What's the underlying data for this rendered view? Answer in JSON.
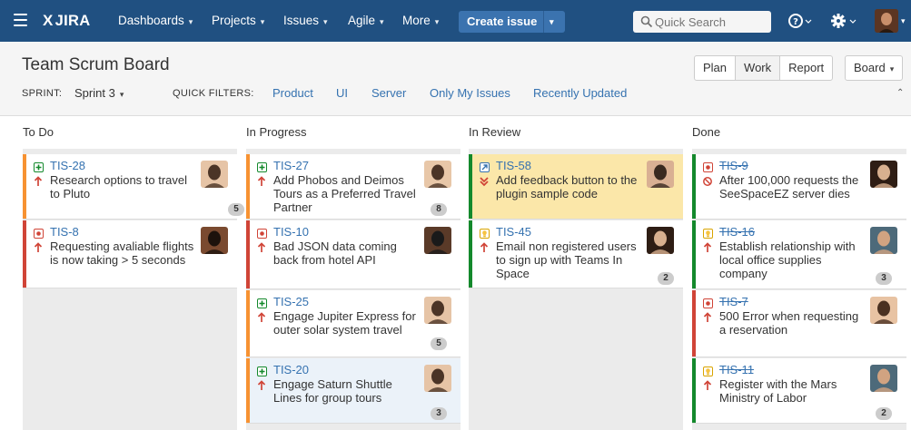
{
  "nav": {
    "logo": "JIRA",
    "logo_mark": "X",
    "items": [
      "Dashboards",
      "Projects",
      "Issues",
      "Agile",
      "More"
    ],
    "create_label": "Create issue",
    "search_placeholder": "Quick Search",
    "help_icon": "help-icon",
    "settings_icon": "gear-icon",
    "brand_color": "#205081",
    "create_color": "#3b73af"
  },
  "board": {
    "title": "Team Scrum Board",
    "sprint_label": "SPRINT:",
    "sprint_value": "Sprint 3",
    "quick_filters_label": "QUICK FILTERS:",
    "quick_filters": [
      "Product",
      "UI",
      "Server",
      "Only My Issues",
      "Recently Updated"
    ],
    "modes": [
      "Plan",
      "Work",
      "Report"
    ],
    "active_mode": "Work",
    "board_menu": "Board"
  },
  "columns": [
    {
      "name": "To Do",
      "cards": [
        {
          "key": "TIS-28",
          "type": "story",
          "priority": "major",
          "summary": "Research options to travel to Pluto",
          "estimate": "5",
          "bar": "#f79232"
        },
        {
          "key": "TIS-8",
          "type": "bug",
          "priority": "major",
          "summary": "Requesting avaliable flights is now taking > 5 seconds",
          "estimate": "",
          "bar": "#d04437"
        }
      ]
    },
    {
      "name": "In Progress",
      "cards": [
        {
          "key": "TIS-27",
          "type": "story",
          "priority": "major",
          "summary": "Add Phobos and Deimos Tours as a Preferred Travel Partner",
          "estimate": "8",
          "bar": "#f79232"
        },
        {
          "key": "TIS-10",
          "type": "bug",
          "priority": "major",
          "summary": "Bad JSON data coming back from hotel API",
          "estimate": "",
          "bar": "#d04437"
        },
        {
          "key": "TIS-25",
          "type": "story",
          "priority": "major",
          "summary": "Engage Jupiter Express for outer solar system travel",
          "estimate": "5",
          "bar": "#f79232"
        },
        {
          "key": "TIS-20",
          "type": "story",
          "priority": "major",
          "summary": "Engage Saturn Shuttle Lines for group tours",
          "estimate": "3",
          "bar": "#f79232"
        }
      ]
    },
    {
      "name": "In Review",
      "cards": [
        {
          "key": "TIS-58",
          "type": "improvement",
          "priority": "blocker",
          "summary": "Add feedback button to the plugin sample code",
          "estimate": "",
          "bar": "#14892c",
          "flagged": true
        },
        {
          "key": "TIS-45",
          "type": "idea",
          "priority": "major",
          "summary": "Email non registered users to sign up with Teams In Space",
          "estimate": "2",
          "bar": "#14892c"
        }
      ]
    },
    {
      "name": "Done",
      "cards": [
        {
          "key": "TIS-9",
          "type": "bug",
          "priority": "blocker",
          "summary": "After 100,000 requests the SeeSpaceEZ server dies",
          "estimate": "",
          "bar": "#14892c",
          "done": true
        },
        {
          "key": "TIS-16",
          "type": "idea",
          "priority": "major",
          "summary": "Establish relationship with local office supplies company",
          "estimate": "3",
          "bar": "#14892c",
          "done": true
        },
        {
          "key": "TIS-7",
          "type": "bug",
          "priority": "major",
          "summary": "500 Error when requesting a reservation",
          "estimate": "",
          "bar": "#d04437",
          "done": true
        },
        {
          "key": "TIS-11",
          "type": "idea",
          "priority": "major",
          "summary": "Register with the Mars Ministry of Labor",
          "estimate": "2",
          "bar": "#14892c",
          "done": true
        }
      ]
    }
  ]
}
